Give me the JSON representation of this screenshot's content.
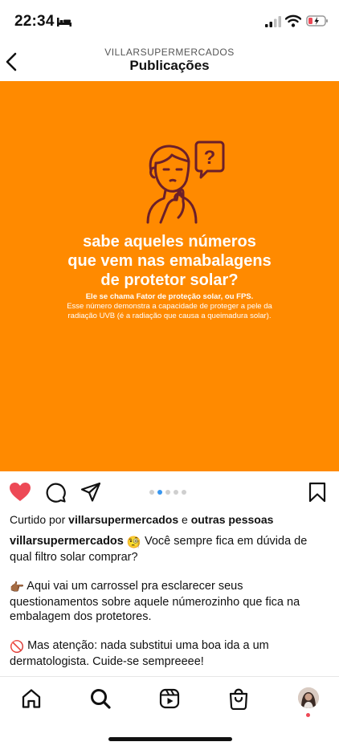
{
  "status_bar": {
    "time": "22:34",
    "icons": [
      "bed-icon",
      "signal-icon",
      "wifi-icon",
      "battery-icon"
    ]
  },
  "header": {
    "account": "VILLARSUPERMERCADOS",
    "title": "Publicações"
  },
  "post": {
    "background_color": "#FF8A00",
    "illustration_icon": "thinking-person-question-icon",
    "headline": [
      "sabe aqueles números",
      "que vem nas emabalagens",
      "de protetor solar?"
    ],
    "subheading": "Ele se chama Fator de proteção solar, ou FPS.",
    "body": [
      "Esse número demonstra a capacidade de proteger a pele da",
      "radiação UVB (é a radiação que causa a queimadura solar)."
    ],
    "carousel": {
      "total": 5,
      "active_index": 1
    }
  },
  "actions": {
    "icons": [
      "heart-icon",
      "comment-icon",
      "share-icon",
      "bookmark-icon"
    ],
    "liked": true,
    "like_color": "#ED4956"
  },
  "likes": {
    "prefix": "Curtido por ",
    "user": "villarsupermercados",
    "middle": " e ",
    "others": "outras pessoas"
  },
  "caption": {
    "username": "villarsupermercados",
    "emoji1": "🧐",
    "line1": " Você sempre fica em dúvida de qual filtro solar comprar?",
    "emoji2": "👉🏾",
    "line2": " Aqui vai um carrossel pra esclarecer seus questionamentos sobre aquele númerozinho que fica na embalagem dos protetores.",
    "emoji3": "🚫",
    "line3": " Mas atenção: nada substitui uma boa ida a um dermatologista. Cuide-se sempreeee!"
  },
  "bottom_nav": {
    "items": [
      "home-icon",
      "search-icon",
      "reels-icon",
      "shop-icon",
      "profile-avatar"
    ],
    "notification_color": "#ED4956"
  }
}
